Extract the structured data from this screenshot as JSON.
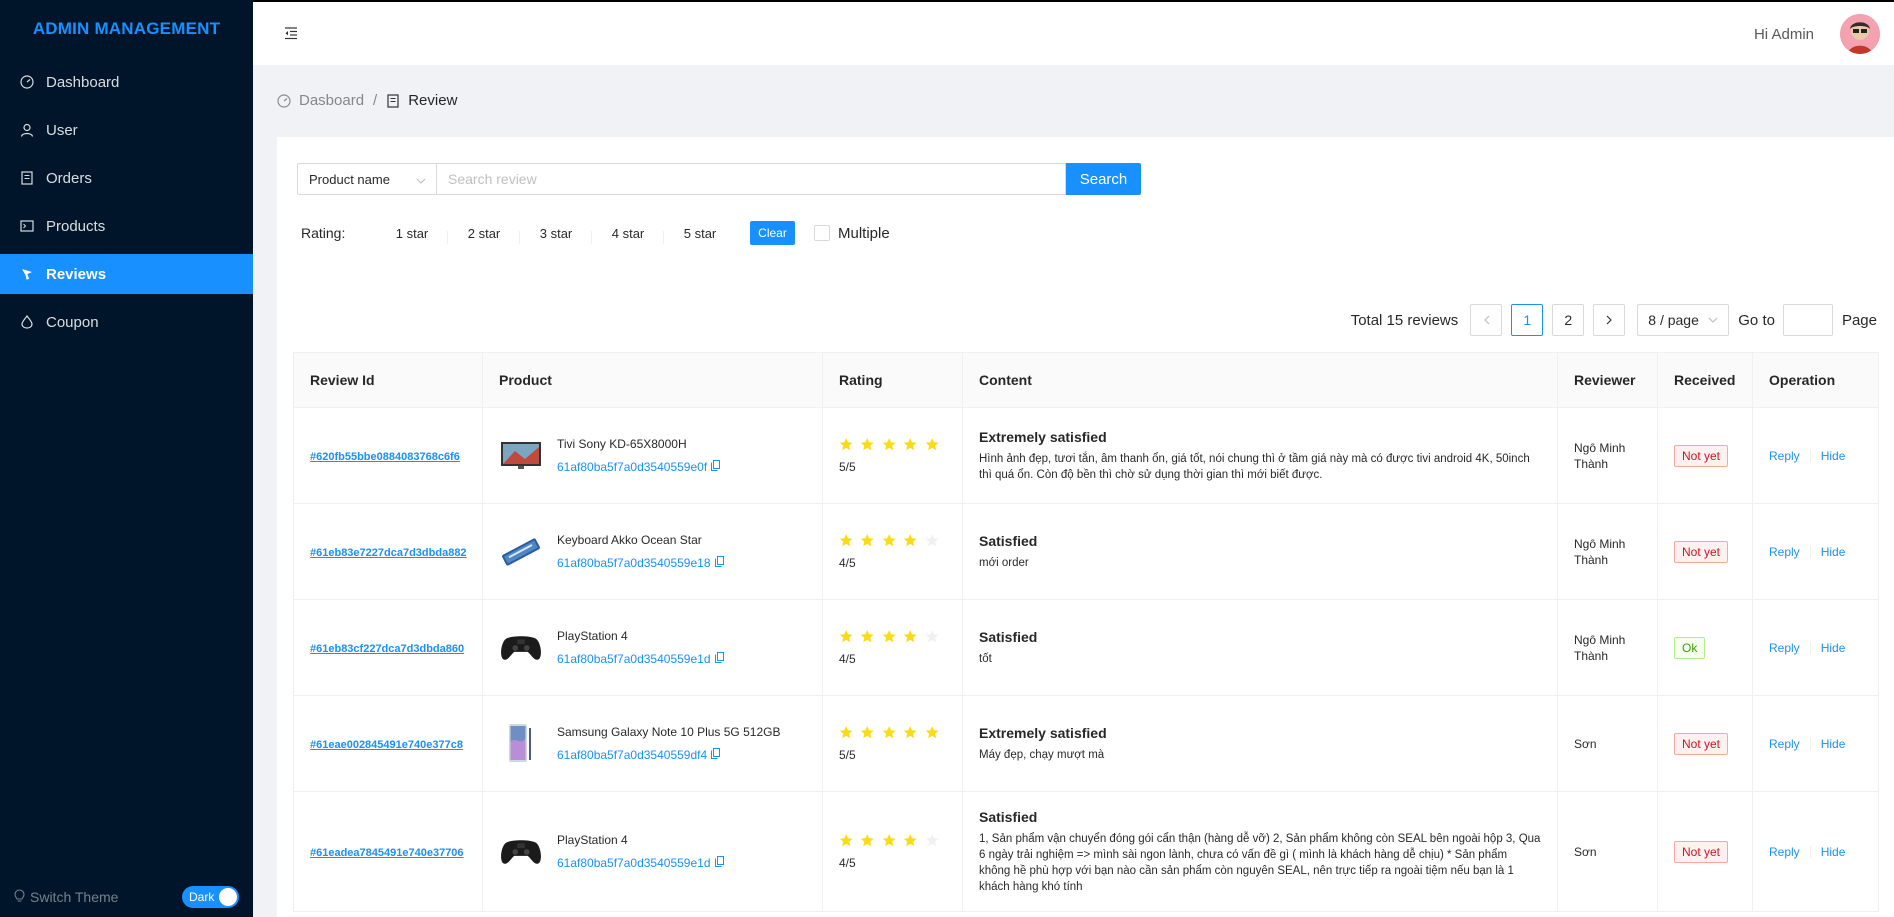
{
  "app": {
    "title": "ADMIN MANAGEMENT"
  },
  "sidebar": {
    "items": [
      {
        "label": "Dashboard",
        "icon": "dashboard-icon"
      },
      {
        "label": "User",
        "icon": "user-icon"
      },
      {
        "label": "Orders",
        "icon": "orders-icon"
      },
      {
        "label": "Products",
        "icon": "products-icon"
      },
      {
        "label": "Reviews",
        "icon": "reviews-icon",
        "active": true
      },
      {
        "label": "Coupon",
        "icon": "coupon-icon"
      }
    ],
    "switch_theme_label": "Switch Theme",
    "theme_toggle_label": "Dark"
  },
  "header": {
    "greeting": "Hi Admin"
  },
  "breadcrumb": {
    "home": "Dasboard",
    "separator": "/",
    "current": "Review"
  },
  "search": {
    "field_select": "Product name",
    "placeholder": "Search review",
    "button": "Search"
  },
  "rating_filter": {
    "label": "Rating:",
    "options": [
      "1 star",
      "2 star",
      "3 star",
      "4 star",
      "5 star"
    ],
    "clear": "Clear",
    "multiple": "Multiple"
  },
  "pagination": {
    "total_text": "Total 15 reviews",
    "pages": [
      "1",
      "2"
    ],
    "current": "1",
    "page_size": "8 / page",
    "goto_label": "Go to",
    "page_label": "Page"
  },
  "table": {
    "headers": [
      "Review Id",
      "Product",
      "Rating",
      "Content",
      "Reviewer",
      "Received",
      "Operation"
    ],
    "rows": [
      {
        "id": "#620fb55bbe0884083768c6f6",
        "product": "Tivi Sony KD-65X8000H",
        "product_id": "61af80ba5f7a0d3540559e0f",
        "rating": 5,
        "rating_text": "5/5",
        "title": "Extremely satisfied",
        "content": "Hình ảnh đẹp, tươi tắn, âm thanh ổn, giá tốt, nói chung thì ở tầm giá này mà có được tivi android 4K, 50inch thì quá ổn. Còn độ bền thì chờ sử dụng thời gian thì mới biết được.",
        "reviewer": "Ngô Minh Thành",
        "received": "Not yet",
        "reply": "Reply",
        "hide": "Hide"
      },
      {
        "id": "#61eb83e7227dca7d3dbda882",
        "product": "Keyboard Akko Ocean Star",
        "product_id": "61af80ba5f7a0d3540559e18",
        "rating": 4,
        "rating_text": "4/5",
        "title": "Satisfied",
        "content": "mới order",
        "reviewer": "Ngô Minh Thành",
        "received": "Not yet",
        "reply": "Reply",
        "hide": "Hide"
      },
      {
        "id": "#61eb83cf227dca7d3dbda860",
        "product": "PlayStation 4",
        "product_id": "61af80ba5f7a0d3540559e1d",
        "rating": 4,
        "rating_text": "4/5",
        "title": "Satisfied",
        "content": "tốt",
        "reviewer": "Ngô Minh Thành",
        "received": "Ok",
        "reply": "Reply",
        "hide": "Hide"
      },
      {
        "id": "#61eae002845491e740e377c8",
        "product": "Samsung Galaxy Note 10 Plus 5G 512GB",
        "product_id": "61af80ba5f7a0d3540559df4",
        "rating": 5,
        "rating_text": "5/5",
        "title": "Extremely satisfied",
        "content": "Máy đẹp, chạy mượt mà",
        "reviewer": "Sơn",
        "received": "Not yet",
        "reply": "Reply",
        "hide": "Hide"
      },
      {
        "id": "#61eadea7845491e740e37706",
        "product": "PlayStation 4",
        "product_id": "61af80ba5f7a0d3540559e1d",
        "rating": 4,
        "rating_text": "4/5",
        "title": "Satisfied",
        "content": "1, Sản phẩm vận chuyển đóng gói cẩn thận (hàng dễ vỡ) 2, Sản phẩm không còn SEAL bên ngoài hộp 3, Qua 6 ngày trải nghiệm => mình sài ngon lành, chưa có vấn đề gì ( mình là khách hàng dễ chịu) * Sản phẩm không hề phù hợp với bạn nào cần sản phẩm còn nguyên SEAL, nên trực tiếp ra ngoài tiệm nếu bạn là 1 khách hàng khó tính",
        "reviewer": "Sơn",
        "received": "Not yet",
        "reply": "Reply",
        "hide": "Hide"
      }
    ]
  },
  "colors": {
    "primary": "#1890ff",
    "sidebar_bg": "#001529",
    "star": "#fadb14",
    "star_empty": "#f0f0f0"
  }
}
